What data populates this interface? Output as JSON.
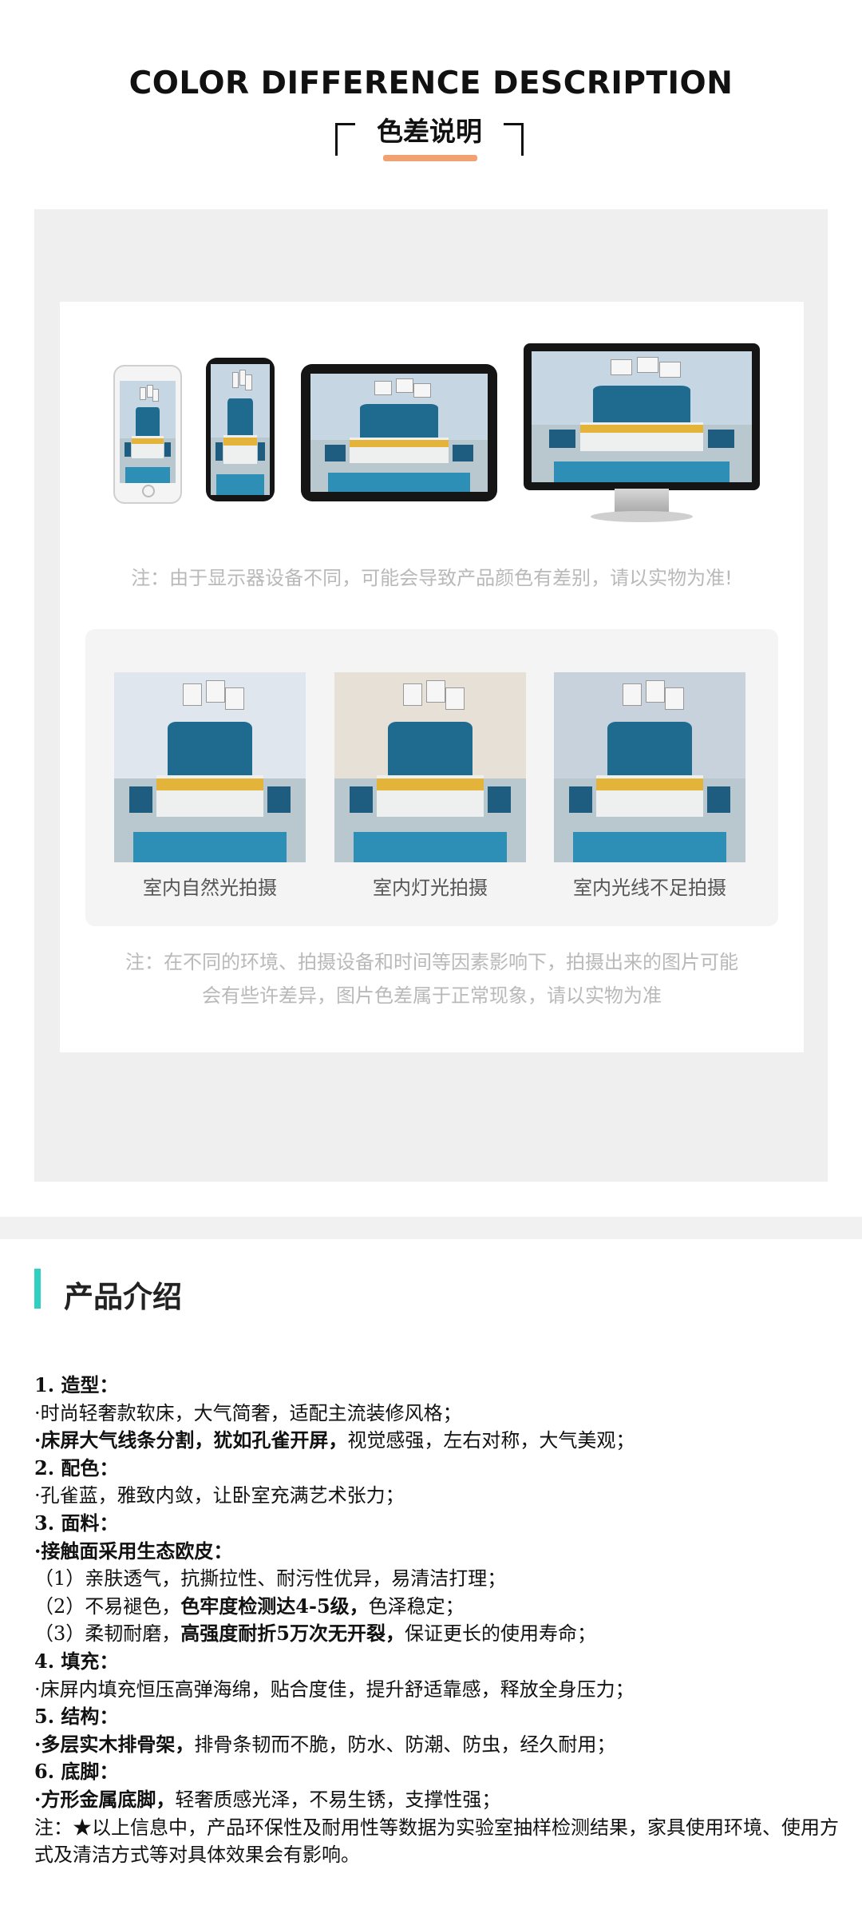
{
  "header": {
    "title_en": "COLOR DIFFERENCE DESCRIPTION",
    "title_cn": "色差说明"
  },
  "colors": {
    "accent_orange": "#f2a170",
    "accent_teal": "#2fd0c2",
    "panel_grey": "#efefef",
    "bed_blue": "#1f6a8f"
  },
  "devices": {
    "items": [
      "phone-white",
      "phone-black",
      "tablet",
      "monitor"
    ],
    "note": "注：由于显示器设备不同，可能会导致产品颜色有差别，请以实物为准!"
  },
  "lighting": {
    "captions": [
      "室内自然光拍摄",
      "室内灯光拍摄",
      "室内光线不足拍摄"
    ],
    "note_line1": "注：在不同的环境、拍摄设备和时间等因素影响下，拍摄出来的图片可能",
    "note_line2": "会有些许差异，图片色差属于正常现象，请以实物为准"
  },
  "product": {
    "section_title": "产品介绍",
    "spec": {
      "s1_head": "1. 造型：",
      "s1_l1": "·时尚轻奢款软床，大气简奢，适配主流装修风格；",
      "s1_l2_bold": "·床屏大气线条分割，犹如孔雀开屏，",
      "s1_l2_rest": "视觉感强，左右对称，大气美观；",
      "s2_head": "2. 配色：",
      "s2_l1": "·孔雀蓝，雅致内敛，让卧室充满艺术张力；",
      "s3_head": "3. 面料：",
      "s3_l1_bold": "·接触面采用生态欧皮：",
      "s3_l2": "（1）亲肤透气，抗撕拉性、耐污性优异，易清洁打理；",
      "s3_l3_a": "（2）不易褪色，",
      "s3_l3_bold": "色牢度检测达4-5级，",
      "s3_l3_b": "色泽稳定；",
      "s3_l4_a": "（3）柔韧耐磨，",
      "s3_l4_bold": "高强度耐折5万次无开裂，",
      "s3_l4_b": "保证更长的使用寿命；",
      "s4_head": "4. 填充：",
      "s4_l1": "·床屏内填充恒压高弹海绵，贴合度佳，提升舒适靠感，释放全身压力；",
      "s5_head": "5. 结构：",
      "s5_l1_bold": "·多层实木排骨架，",
      "s5_l1_rest": "排骨条韧而不脆，防水、防潮、防虫，经久耐用；",
      "s6_head": "6. 底脚：",
      "s6_l1_bold": "·方形金属底脚，",
      "s6_l1_rest": "轻奢质感光泽，不易生锈，支撑性强；",
      "note": "注：★以上信息中，产品环保性及耐用性等数据为实验室抽样检测结果，家具使用环境、使用方式及清洁方式等对具体效果会有影响。"
    }
  }
}
